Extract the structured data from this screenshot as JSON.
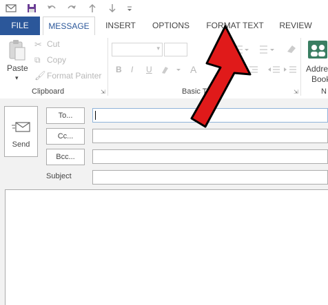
{
  "tabs": {
    "file": "FILE",
    "message": "MESSAGE",
    "insert": "INSERT",
    "options": "OPTIONS",
    "format_text": "FORMAT TEXT",
    "review": "REVIEW"
  },
  "clipboard": {
    "paste": "Paste",
    "cut": "Cut",
    "copy": "Copy",
    "format_painter": "Format Painter",
    "group_label": "Clipboard"
  },
  "basic_text": {
    "group_label_partial": "Basic Text",
    "bold": "B",
    "italic": "I",
    "underline": "U",
    "font_color": "A"
  },
  "names": {
    "address_book_line1": "Addre",
    "address_book_line2": "Book",
    "group_label_partial": "N"
  },
  "compose": {
    "send": "Send",
    "to": "To...",
    "cc": "Cc...",
    "bcc": "Bcc...",
    "subject": "Subject"
  },
  "colors": {
    "accent": "#2b579a",
    "arrow": "#e01a1a"
  }
}
